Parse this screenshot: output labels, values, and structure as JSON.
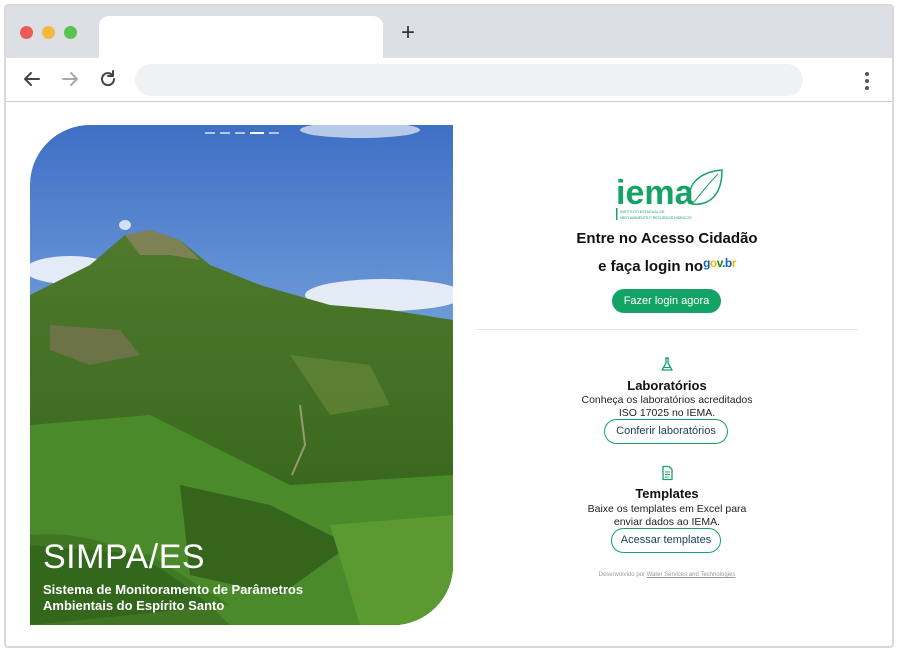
{
  "browser": {
    "new_tab_label": "+",
    "address": ""
  },
  "hero": {
    "title": "SIMPA/ES",
    "subtitle": "Sistema de Monitoramento de Parâmetros Ambientais do Espírito Santo",
    "carousel_total": 5,
    "carousel_active": 4
  },
  "login": {
    "logo_text": "iema",
    "logo_caption": "INSTITUTO ESTADUAL DE MEIO AMBIENTE E RECURSOS HÍDRICOS",
    "heading": "Entre no Acesso Cidadão",
    "line2": "e faça login no",
    "govbr": "gov.br",
    "button": "Fazer login agora"
  },
  "labs": {
    "icon": "flask-icon",
    "title": "Laboratórios",
    "description": "Conheça os laboratórios acreditados ISO 17025 no IEMA.",
    "button": "Conferir laboratórios"
  },
  "templates": {
    "icon": "document-icon",
    "title": "Templates",
    "description": "Baixe os templates em Excel para enviar dados ao IEMA.",
    "button": "Acessar templates"
  },
  "footer": {
    "prefix": "Desenvolvido por ",
    "link": "Water Services and Technologies"
  },
  "colors": {
    "accent": "#14a366",
    "text_dark": "#111111"
  }
}
